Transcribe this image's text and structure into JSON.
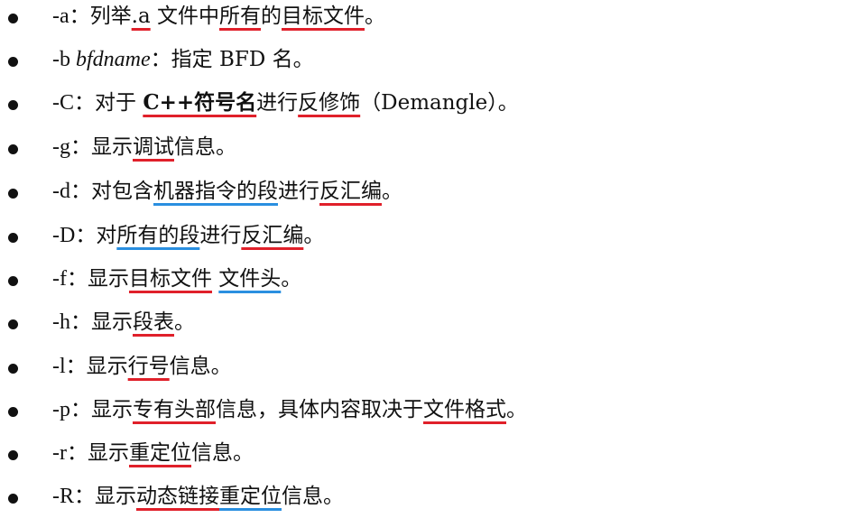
{
  "colors": {
    "text": "#111111",
    "underline_red": "#e0202a",
    "underline_blue": "#2a8fe0",
    "background": "#ffffff"
  },
  "items": [
    {
      "flag": "-a",
      "arg": "",
      "colon": "：",
      "segments": [
        {
          "text": "列举",
          "mark": ""
        },
        {
          "text": ".a",
          "mark": "red"
        },
        {
          "text": " 文件中",
          "mark": ""
        },
        {
          "text": "所有",
          "mark": "red"
        },
        {
          "text": "的",
          "mark": ""
        },
        {
          "text": "目标文件",
          "mark": "red"
        },
        {
          "text": "。",
          "mark": ""
        }
      ]
    },
    {
      "flag": "-b ",
      "arg": "bfdname",
      "colon": "：",
      "segments": [
        {
          "text": "指定 BFD 名。",
          "mark": ""
        }
      ]
    },
    {
      "flag": "-C",
      "arg": "",
      "colon": "：",
      "segments": [
        {
          "text": "对于 ",
          "mark": ""
        },
        {
          "text": "C++符号名",
          "mark": "red",
          "bold": true
        },
        {
          "text": "进行",
          "mark": ""
        },
        {
          "text": "反修饰",
          "mark": "red"
        },
        {
          "text": "（Demangle）。",
          "mark": ""
        }
      ]
    },
    {
      "flag": "-g",
      "arg": "",
      "colon": "：",
      "segments": [
        {
          "text": "显示",
          "mark": ""
        },
        {
          "text": "调试",
          "mark": "red"
        },
        {
          "text": "信息。",
          "mark": ""
        }
      ]
    },
    {
      "flag": "-d",
      "arg": "",
      "colon": "：",
      "segments": [
        {
          "text": "对包含",
          "mark": ""
        },
        {
          "text": "机器指令的段",
          "mark": "blue"
        },
        {
          "text": "进行",
          "mark": ""
        },
        {
          "text": "反汇编",
          "mark": "red"
        },
        {
          "text": "。",
          "mark": ""
        }
      ]
    },
    {
      "flag": "-D",
      "arg": "",
      "colon": "：",
      "segments": [
        {
          "text": "对",
          "mark": ""
        },
        {
          "text": "所有的段",
          "mark": "blue"
        },
        {
          "text": "进行",
          "mark": ""
        },
        {
          "text": "反汇编",
          "mark": "red"
        },
        {
          "text": "。",
          "mark": ""
        }
      ]
    },
    {
      "flag": "-f",
      "arg": "",
      "colon": "：",
      "segments": [
        {
          "text": "显示",
          "mark": ""
        },
        {
          "text": "目标文件",
          "mark": "red"
        },
        {
          "text": " ",
          "mark": ""
        },
        {
          "text": "文件头",
          "mark": "blue"
        },
        {
          "text": "。",
          "mark": ""
        }
      ]
    },
    {
      "flag": "-h",
      "arg": "",
      "colon": "：",
      "segments": [
        {
          "text": "显示",
          "mark": ""
        },
        {
          "text": "段表",
          "mark": "red"
        },
        {
          "text": "。",
          "mark": ""
        }
      ]
    },
    {
      "flag": "-l",
      "arg": "",
      "colon": "：",
      "segments": [
        {
          "text": "显示",
          "mark": ""
        },
        {
          "text": "行号",
          "mark": "red"
        },
        {
          "text": "信息。",
          "mark": ""
        }
      ]
    },
    {
      "flag": "-p",
      "arg": "",
      "colon": "：",
      "segments": [
        {
          "text": "显示",
          "mark": ""
        },
        {
          "text": "专有头部",
          "mark": "red"
        },
        {
          "text": "信息，具体内容取决于",
          "mark": ""
        },
        {
          "text": "文件格式",
          "mark": "red"
        },
        {
          "text": "。",
          "mark": ""
        }
      ]
    },
    {
      "flag": "-r",
      "arg": "",
      "colon": "：",
      "segments": [
        {
          "text": "显示",
          "mark": ""
        },
        {
          "text": "重定位",
          "mark": "red"
        },
        {
          "text": "信息。",
          "mark": ""
        }
      ]
    },
    {
      "flag": "-R",
      "arg": "",
      "colon": "：",
      "segments": [
        {
          "text": "显示",
          "mark": ""
        },
        {
          "text": "动态链接",
          "mark": "red"
        },
        {
          "text": "重定位",
          "mark": "blue"
        },
        {
          "text": "信息。",
          "mark": ""
        }
      ]
    }
  ]
}
